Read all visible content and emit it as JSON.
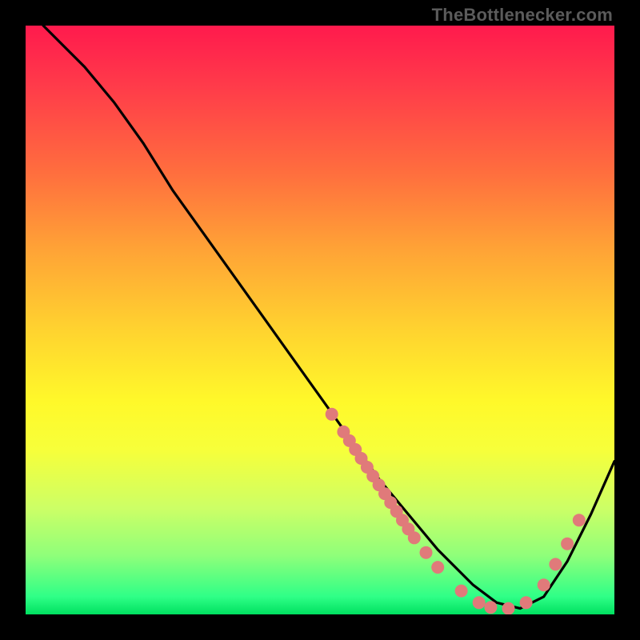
{
  "watermark": "TheBottlenecker.com",
  "chart_data": {
    "type": "line",
    "title": "",
    "xlabel": "",
    "ylabel": "",
    "xlim": [
      0,
      100
    ],
    "ylim": [
      0,
      100
    ],
    "series": [
      {
        "name": "curve",
        "x": [
          3,
          6,
          10,
          15,
          20,
          25,
          30,
          35,
          40,
          45,
          50,
          55,
          60,
          65,
          70,
          72,
          76,
          80,
          84,
          88,
          92,
          96,
          100
        ],
        "values": [
          100,
          97,
          93,
          87,
          80,
          72,
          65,
          58,
          51,
          44,
          37,
          30,
          23,
          17,
          11,
          9,
          5,
          2,
          1,
          3,
          9,
          17,
          26
        ]
      }
    ],
    "markers": [
      {
        "x": 52,
        "y": 34
      },
      {
        "x": 54,
        "y": 31
      },
      {
        "x": 55,
        "y": 29.5
      },
      {
        "x": 56,
        "y": 28
      },
      {
        "x": 57,
        "y": 26.5
      },
      {
        "x": 58,
        "y": 25
      },
      {
        "x": 59,
        "y": 23.5
      },
      {
        "x": 60,
        "y": 22
      },
      {
        "x": 61,
        "y": 20.5
      },
      {
        "x": 62,
        "y": 19
      },
      {
        "x": 63,
        "y": 17.5
      },
      {
        "x": 64,
        "y": 16
      },
      {
        "x": 65,
        "y": 14.5
      },
      {
        "x": 66,
        "y": 13
      },
      {
        "x": 68,
        "y": 10.5
      },
      {
        "x": 70,
        "y": 8
      },
      {
        "x": 74,
        "y": 4
      },
      {
        "x": 77,
        "y": 2
      },
      {
        "x": 79,
        "y": 1.2
      },
      {
        "x": 82,
        "y": 1
      },
      {
        "x": 85,
        "y": 2
      },
      {
        "x": 88,
        "y": 5
      },
      {
        "x": 90,
        "y": 8.5
      },
      {
        "x": 92,
        "y": 12
      },
      {
        "x": 94,
        "y": 16
      }
    ],
    "colors": {
      "curve": "#000000",
      "marker": "#e07a7a"
    }
  }
}
